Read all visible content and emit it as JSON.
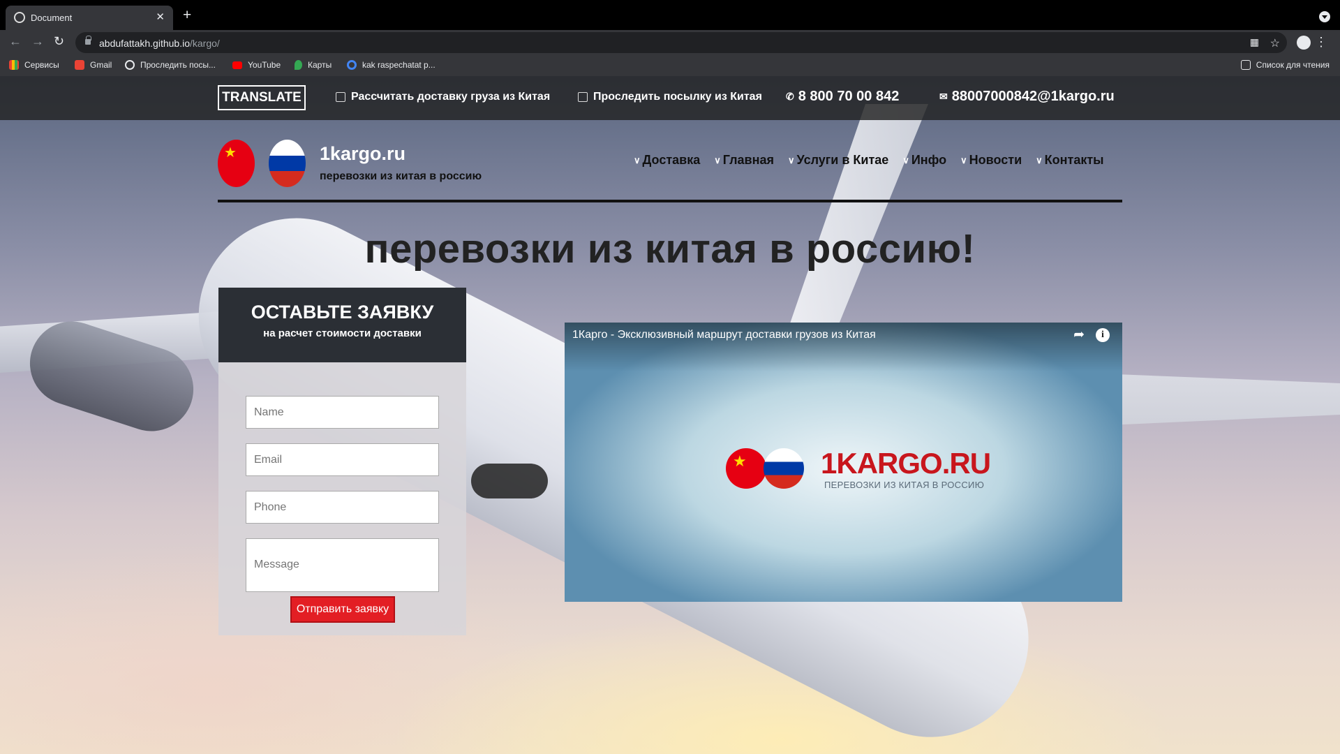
{
  "browser": {
    "tab_title": "Document",
    "url_host": "abdufattakh.github.io",
    "url_path": "/kargo/",
    "bookmarks": [
      "Сервисы",
      "Gmail",
      "Проследить посы...",
      "YouTube",
      "Карты",
      "kak raspechatat p..."
    ],
    "reading_list": "Список для чтения"
  },
  "infobar": {
    "translate": "TRANSLATE",
    "calc": "Рассчитать доставку груза из Китая",
    "track": "Проследить посылку из Китая",
    "phone": "8 800 70 00 842",
    "email": "88007000842@1kargo.ru"
  },
  "header": {
    "brand_name": "1kargo.ru",
    "brand_sub": "перевозки из китая в россию",
    "nav": [
      "Доставка",
      "Главная",
      "Услуги в Китае",
      "Инфо",
      "Новости",
      "Контакты"
    ]
  },
  "hero": {
    "title": "перевозки из китая в россию!"
  },
  "form": {
    "title": "ОСТАВЬТЕ ЗАЯВКУ",
    "subtitle": "на расчет стоимости доставки",
    "name_placeholder": "Name",
    "email_placeholder": "Email",
    "phone_placeholder": "Phone",
    "message_placeholder": "Message",
    "submit": "Отправить заявку"
  },
  "video": {
    "title": "1Карго - Эксклюзивный маршрут доставки грузов из Китая",
    "logo": "1KARGO.RU",
    "logo_sub": "ПЕРЕВОЗКИ ИЗ КИТАЯ В РОССИЮ"
  },
  "colors": {
    "accent_red": "#e31e24",
    "form_header": "#2b2f35",
    "infobar": "#222222"
  }
}
